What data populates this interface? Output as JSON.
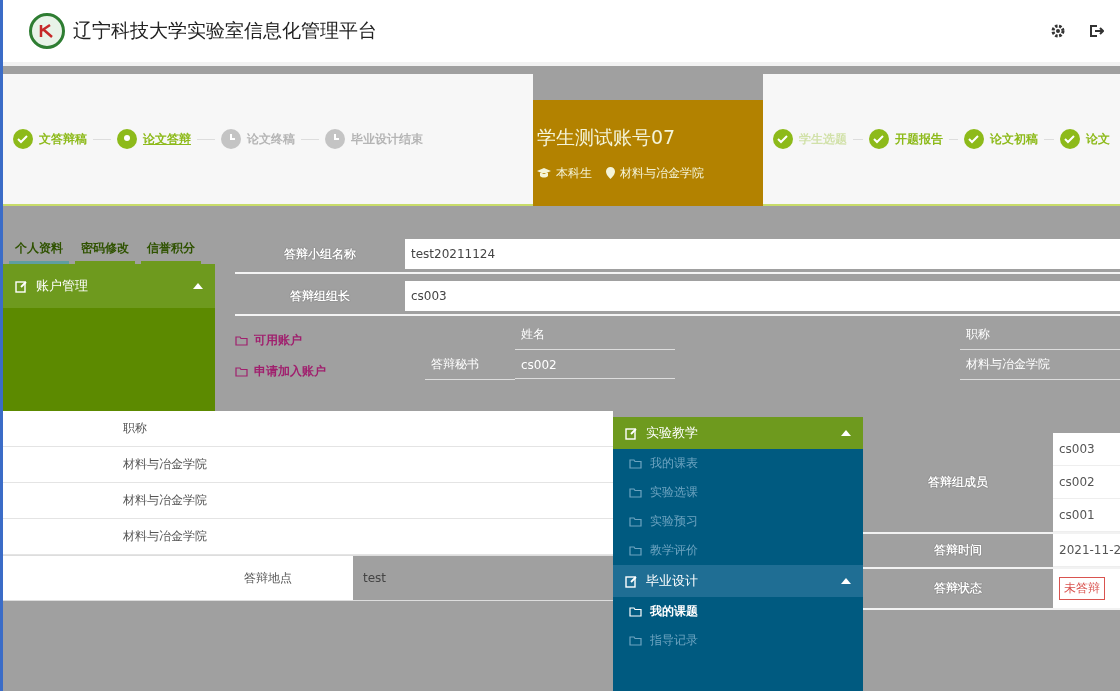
{
  "header": {
    "title": "辽宁科技大学实验室信息化管理平台"
  },
  "steps_left": [
    {
      "label": "文答辩稿",
      "kind": "done"
    },
    {
      "label": "论文答辩",
      "kind": "current"
    },
    {
      "label": "论文终稿",
      "kind": "pending"
    },
    {
      "label": "毕业设计结束",
      "kind": "pending"
    }
  ],
  "profile": {
    "name": "学生测试账号07",
    "role": "本科生",
    "college": "材料与冶金学院"
  },
  "steps_right": [
    {
      "label": "学生选题",
      "kind": "done"
    },
    {
      "label": "开题报告",
      "kind": "done"
    },
    {
      "label": "论文初稿",
      "kind": "done"
    },
    {
      "label": "论文",
      "kind": "done"
    }
  ],
  "account_panel": {
    "tabs": [
      {
        "label": "个人资料",
        "selected": true
      },
      {
        "label": "密码修改",
        "selected": false
      },
      {
        "label": "信誉积分",
        "selected": false
      }
    ],
    "section": {
      "title": "账户管理",
      "expanded": true
    },
    "items": [
      "可用账户",
      "申请加入账户"
    ]
  },
  "form": {
    "rows": [
      {
        "label": "答辩小组名称",
        "value": "test20211124"
      },
      {
        "label": "答辩组组长",
        "value": "cs003"
      }
    ],
    "columns": [
      "姓名",
      "职称"
    ],
    "secretary": {
      "label": "答辩秘书",
      "name": "cs002",
      "college": "材料与冶金学院"
    }
  },
  "left_table": {
    "header": "职称",
    "rows": [
      "材料与冶金学院",
      "材料与冶金学院",
      "材料与冶金学院"
    ],
    "location": {
      "label": "答辩地点",
      "value": "test"
    }
  },
  "menu": [
    {
      "title": "实验教学",
      "expanded": true,
      "items": [
        {
          "label": "我的课表",
          "selected": false
        },
        {
          "label": "实验选课",
          "selected": false
        },
        {
          "label": "实验预习",
          "selected": false
        },
        {
          "label": "教学评价",
          "selected": false
        }
      ]
    },
    {
      "title": "毕业设计",
      "expanded": true,
      "items": [
        {
          "label": "我的课题",
          "selected": true
        },
        {
          "label": "指导记录",
          "selected": false
        }
      ]
    }
  ],
  "details": {
    "members": {
      "label": "答辩组成员",
      "values": [
        "cs003",
        "cs002",
        "cs001"
      ]
    },
    "time": {
      "label": "答辩时间",
      "value": "2021-11-2"
    },
    "status": {
      "label": "答辩状态",
      "value": "未答辩"
    }
  }
}
